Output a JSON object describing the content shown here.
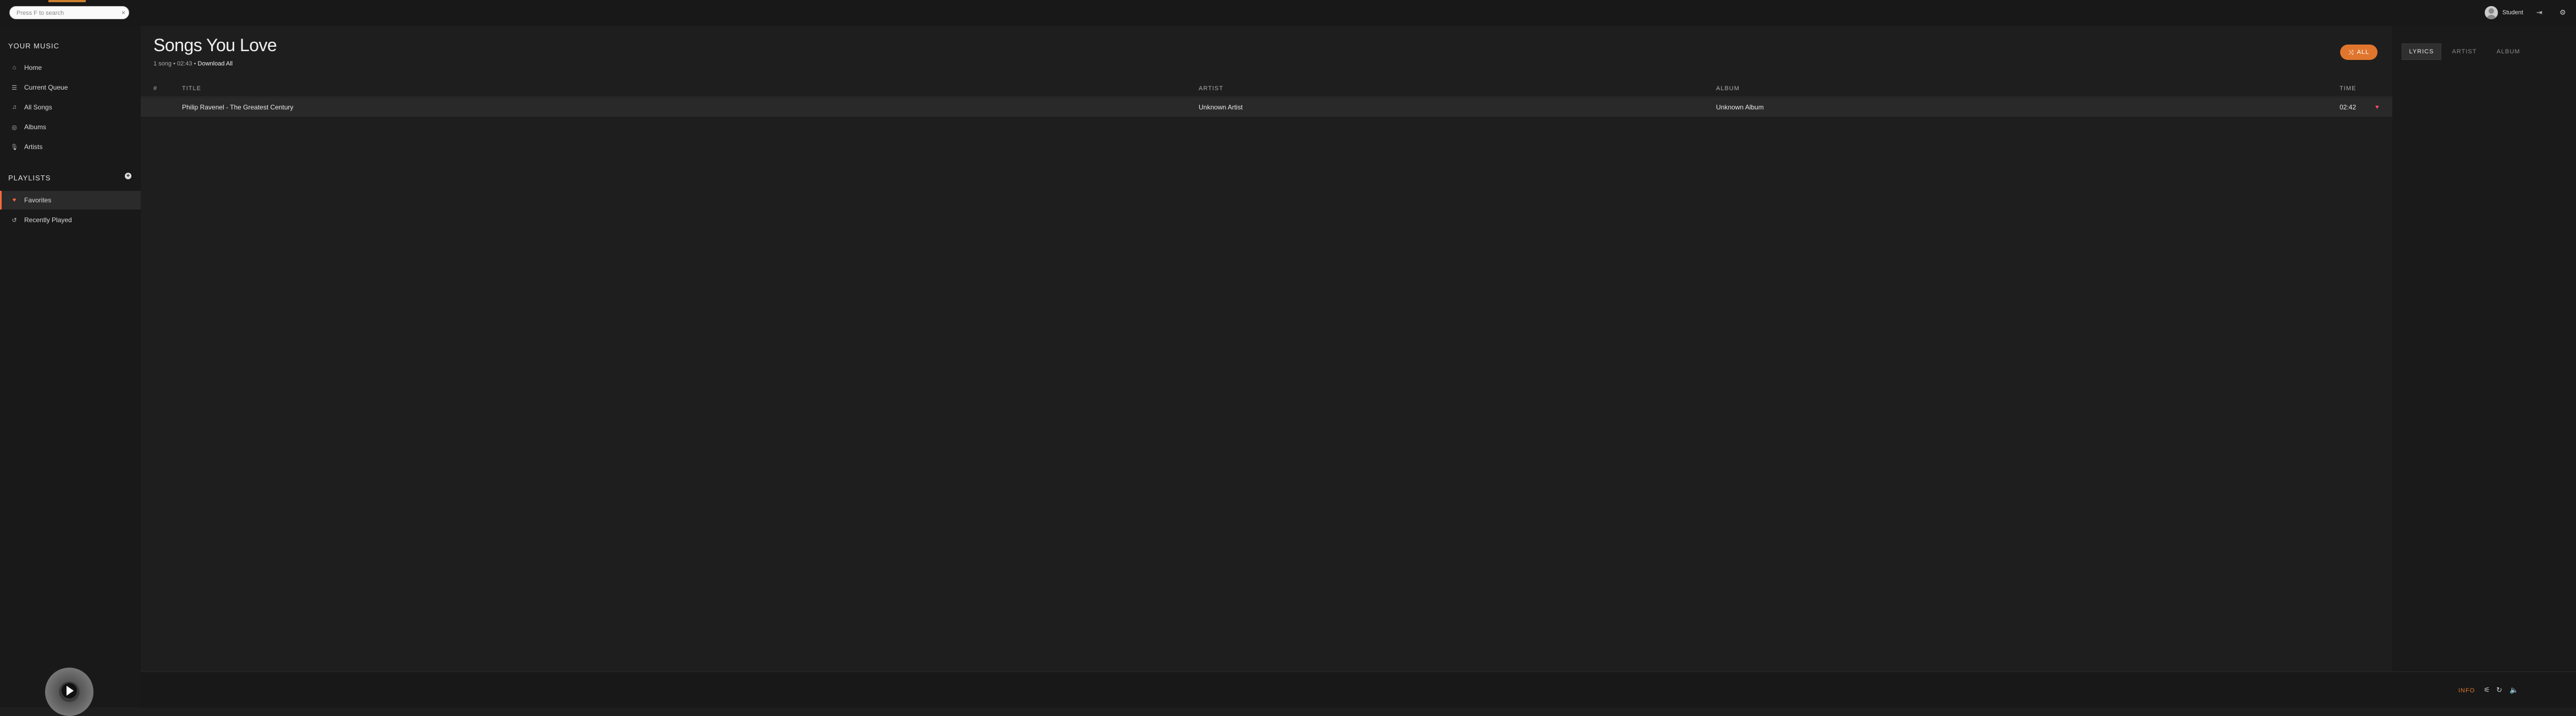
{
  "search": {
    "placeholder": "Press F to search",
    "clear_icon": "x-icon"
  },
  "user": {
    "name": "Student"
  },
  "sidebar": {
    "your_music_heading": "YOUR MUSIC",
    "items": [
      {
        "label": "Home",
        "icon": "home-icon"
      },
      {
        "label": "Current Queue",
        "icon": "queue-icon"
      },
      {
        "label": "All Songs",
        "icon": "music-note-icon"
      },
      {
        "label": "Albums",
        "icon": "disc-icon"
      },
      {
        "label": "Artists",
        "icon": "microphone-icon"
      }
    ],
    "playlists_heading": "PLAYLISTS",
    "playlists": [
      {
        "label": "Favorites",
        "icon": "heart-icon",
        "active": true
      },
      {
        "label": "Recently Played",
        "icon": "history-icon",
        "active": false
      }
    ]
  },
  "main": {
    "title": "Songs You Love",
    "meta_count": "1 song",
    "meta_separator": "•",
    "meta_duration": "02:43",
    "meta_download": "Download All",
    "shuffle_label": "ALL",
    "columns": {
      "num": "#",
      "title": "TITLE",
      "artist": "ARTIST",
      "album": "ALBUM",
      "time": "TIME"
    },
    "songs": [
      {
        "title": "Philip Ravenel - The Greatest Century",
        "artist": "Unknown Artist",
        "album": "Unknown Album",
        "time": "02:42",
        "liked": true
      }
    ]
  },
  "extra_panel": {
    "tabs": [
      "LYRICS",
      "ARTIST",
      "ALBUM"
    ],
    "active_tab": "LYRICS"
  },
  "footer": {
    "info_label": "INFO"
  },
  "colors": {
    "accent": "#e0762d",
    "heart": "#ff4d6a",
    "active_border": "#ff6a3d"
  }
}
